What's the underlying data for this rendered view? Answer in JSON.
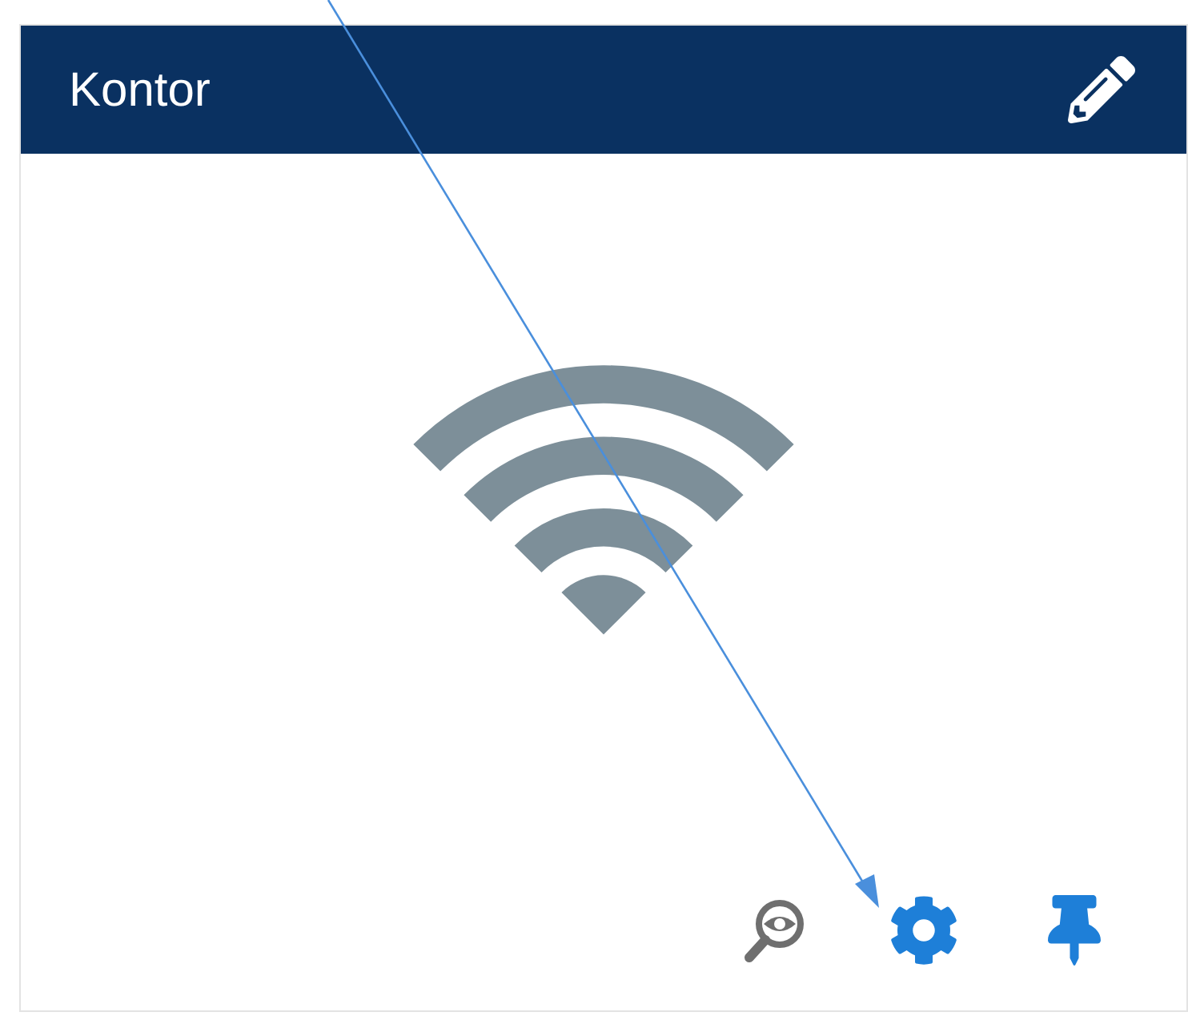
{
  "card": {
    "title": "Kontor"
  }
}
